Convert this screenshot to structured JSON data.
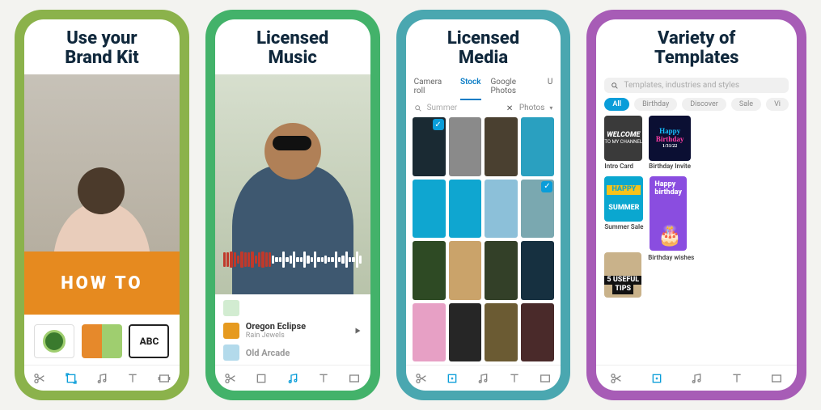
{
  "cards": [
    {
      "title_l1": "Use your",
      "title_l2": "Brand Kit",
      "banner": "HOW TO",
      "font_swatch": "ABC"
    },
    {
      "title_l1": "Licensed",
      "title_l2": "Music",
      "tracks": [
        {
          "name": "Oregon Eclipse",
          "artist": "Rain Jewels",
          "color": "#e69a1f"
        },
        {
          "name": "Old Arcade",
          "artist": "",
          "color": "#6ab6d8"
        }
      ]
    },
    {
      "title_l1": "Licensed",
      "title_l2": "Media",
      "tabs": [
        "Camera roll",
        "Stock",
        "Google Photos",
        "U"
      ],
      "active_tab": "Stock",
      "search_text": "Summer",
      "filter_label": "Photos",
      "thumb_colors": [
        "#1a2a33",
        "#8a8a8a",
        "#4a4030",
        "#2aa0c0",
        "#0fa6d0",
        "#0fa6d0",
        "#8cc0d9",
        "#7aa8b0",
        "#2e4a24",
        "#caa36a",
        "#334028",
        "#163040",
        "#e7a0c5",
        "#262626",
        "#6b5b33",
        "#4a2a2a"
      ],
      "selected": [
        0,
        7
      ]
    },
    {
      "title_l1": "Variety of",
      "title_l2": "Templates",
      "search_placeholder": "Templates, industries and styles",
      "filters": [
        "All",
        "Birthday",
        "Discover",
        "Sale",
        "Vi"
      ],
      "active_filter": "All",
      "templates": {
        "r1a": {
          "line1": "WELCOME",
          "line2": "TO MY CHANNEL",
          "bg": "#3a3a3a",
          "label": "Intro Card"
        },
        "r1b": {
          "line1": "Happy",
          "line2": "Birthday",
          "sub": "1/31/22",
          "bg": "#0b0f33",
          "color": "#16c0ff",
          "label": "Birthday Invite"
        },
        "r2a": {
          "line1": "HAPPY",
          "line2": "SUMMER",
          "bg": "#0aa7d0",
          "accent": "#f6c21a",
          "label": "Summer Sale"
        },
        "r2b": {
          "line1": "Happy",
          "line2": "birthday",
          "bg": "#8a4de0",
          "label": ""
        },
        "r3a": {
          "line1": "5 USEFUL",
          "line2": "TIPS",
          "bg": "#c9b28a",
          "label": ""
        },
        "r3b": {
          "line1": "",
          "line2": "",
          "bg": "#8a4de0",
          "label": "Birthday wishes"
        }
      }
    }
  ],
  "nav": {
    "items": [
      "cut",
      "crop",
      "music",
      "text",
      "format"
    ]
  }
}
